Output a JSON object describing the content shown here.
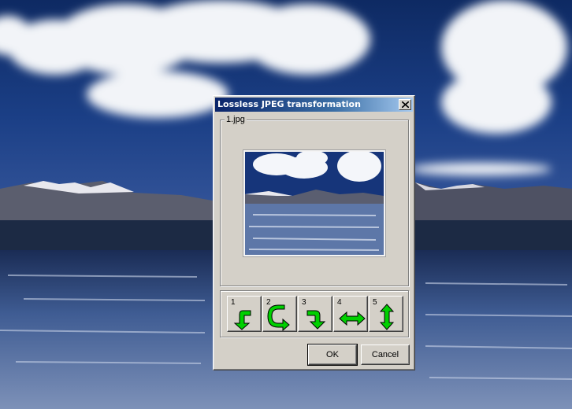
{
  "dialog": {
    "title": "Lossless JPEG transformation",
    "file_label": "1.jpg",
    "transform_buttons": [
      {
        "number": "1",
        "icon": "rotate-left-arrow-icon"
      },
      {
        "number": "2",
        "icon": "rotate-180-arrow-icon"
      },
      {
        "number": "3",
        "icon": "rotate-right-arrow-icon"
      },
      {
        "number": "4",
        "icon": "flip-horizontal-arrow-icon"
      },
      {
        "number": "5",
        "icon": "flip-vertical-arrow-icon"
      }
    ],
    "ok_label": "OK",
    "cancel_label": "Cancel"
  },
  "colors": {
    "titlebar_start": "#0a246a",
    "titlebar_end": "#a6caf0",
    "dialog_face": "#d4d0c8",
    "arrow_green": "#00d000"
  }
}
